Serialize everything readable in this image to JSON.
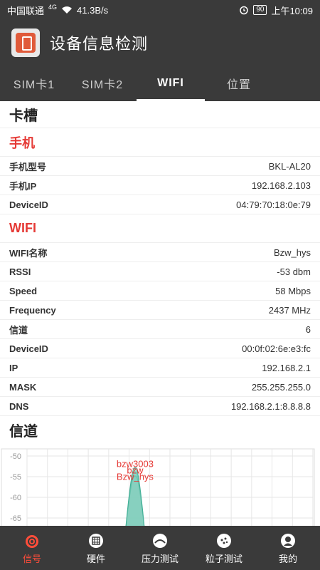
{
  "status_bar": {
    "carrier": "中国联通",
    "net_type": "4G",
    "speed": "41.3B/s",
    "battery": "90",
    "time": "上午10:09"
  },
  "app_bar": {
    "title": "设备信息检测"
  },
  "tabs": [
    {
      "label": "SIM卡1"
    },
    {
      "label": "SIM卡2"
    },
    {
      "label": "WIFI"
    },
    {
      "label": "位置"
    }
  ],
  "sections": {
    "slot_title": "卡槽",
    "phone": {
      "title": "手机",
      "rows": [
        {
          "key": "手机型号",
          "value": "BKL-AL20"
        },
        {
          "key": "手机IP",
          "value": "192.168.2.103"
        },
        {
          "key": "DeviceID",
          "value": "04:79:70:18:0e:79"
        }
      ]
    },
    "wifi": {
      "title": "WIFI",
      "rows": [
        {
          "key": "WIFI名称",
          "value": "Bzw_hys"
        },
        {
          "key": "RSSI",
          "value": "-53 dbm"
        },
        {
          "key": "Speed",
          "value": "58 Mbps"
        },
        {
          "key": "Frequency",
          "value": "2437 MHz"
        },
        {
          "key": "信道",
          "value": "6"
        },
        {
          "key": "DeviceID",
          "value": "00:0f:02:6e:e3:fc"
        },
        {
          "key": "IP",
          "value": "192.168.2.1"
        },
        {
          "key": "MASK",
          "value": "255.255.255.0"
        },
        {
          "key": "DNS",
          "value": "192.168.2.1:8.8.8.8"
        }
      ]
    },
    "channel_title": "信道"
  },
  "chart_data": {
    "type": "area",
    "title": "",
    "xlabel": "",
    "ylabel": "",
    "y_ticks": [
      "-50",
      "-55",
      "-60",
      "-65"
    ],
    "ylim": [
      -65,
      -50
    ],
    "grid": true,
    "series": [
      {
        "name": "bzw3003",
        "channel": 6,
        "peak": -54,
        "color": "#7fcdbb"
      },
      {
        "name": "bzw",
        "channel": 6,
        "peak": -55,
        "color": "#7fcdbb"
      },
      {
        "name": "Bzw_hys",
        "channel": 6,
        "peak": -53,
        "color": "#7fcdbb"
      }
    ],
    "label_color": "#e53935"
  },
  "bottom_nav": [
    {
      "label": "信号",
      "icon": "signal-icon"
    },
    {
      "label": "硬件",
      "icon": "hardware-icon"
    },
    {
      "label": "压力测试",
      "icon": "pressure-test-icon"
    },
    {
      "label": "粒子测试",
      "icon": "particle-test-icon"
    },
    {
      "label": "我的",
      "icon": "profile-icon"
    }
  ]
}
